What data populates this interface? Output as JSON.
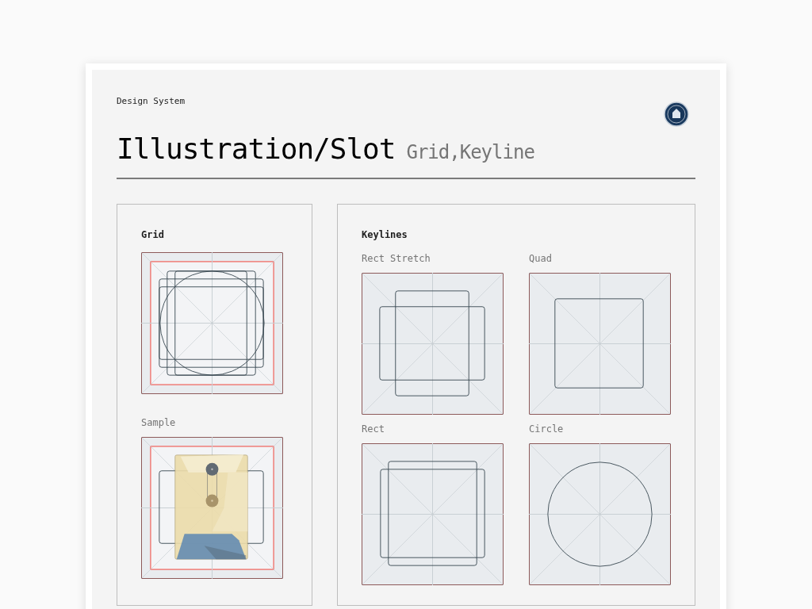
{
  "header": {
    "eyebrow": "Design System",
    "title": "Illustration/Slot",
    "subtitle": "Grid,Keyline"
  },
  "panels": [
    {
      "title": "Grid",
      "items": [
        {
          "kind": "grid"
        },
        {
          "label": "Sample",
          "kind": "sample"
        }
      ]
    },
    {
      "title": "Keylines",
      "items": [
        {
          "label": "Rect Stretch",
          "kind": "rect_stretch"
        },
        {
          "label": "Quad",
          "kind": "quad"
        },
        {
          "label": "Rect",
          "kind": "rect"
        },
        {
          "label": "Circle",
          "kind": "circle"
        }
      ]
    }
  ]
}
